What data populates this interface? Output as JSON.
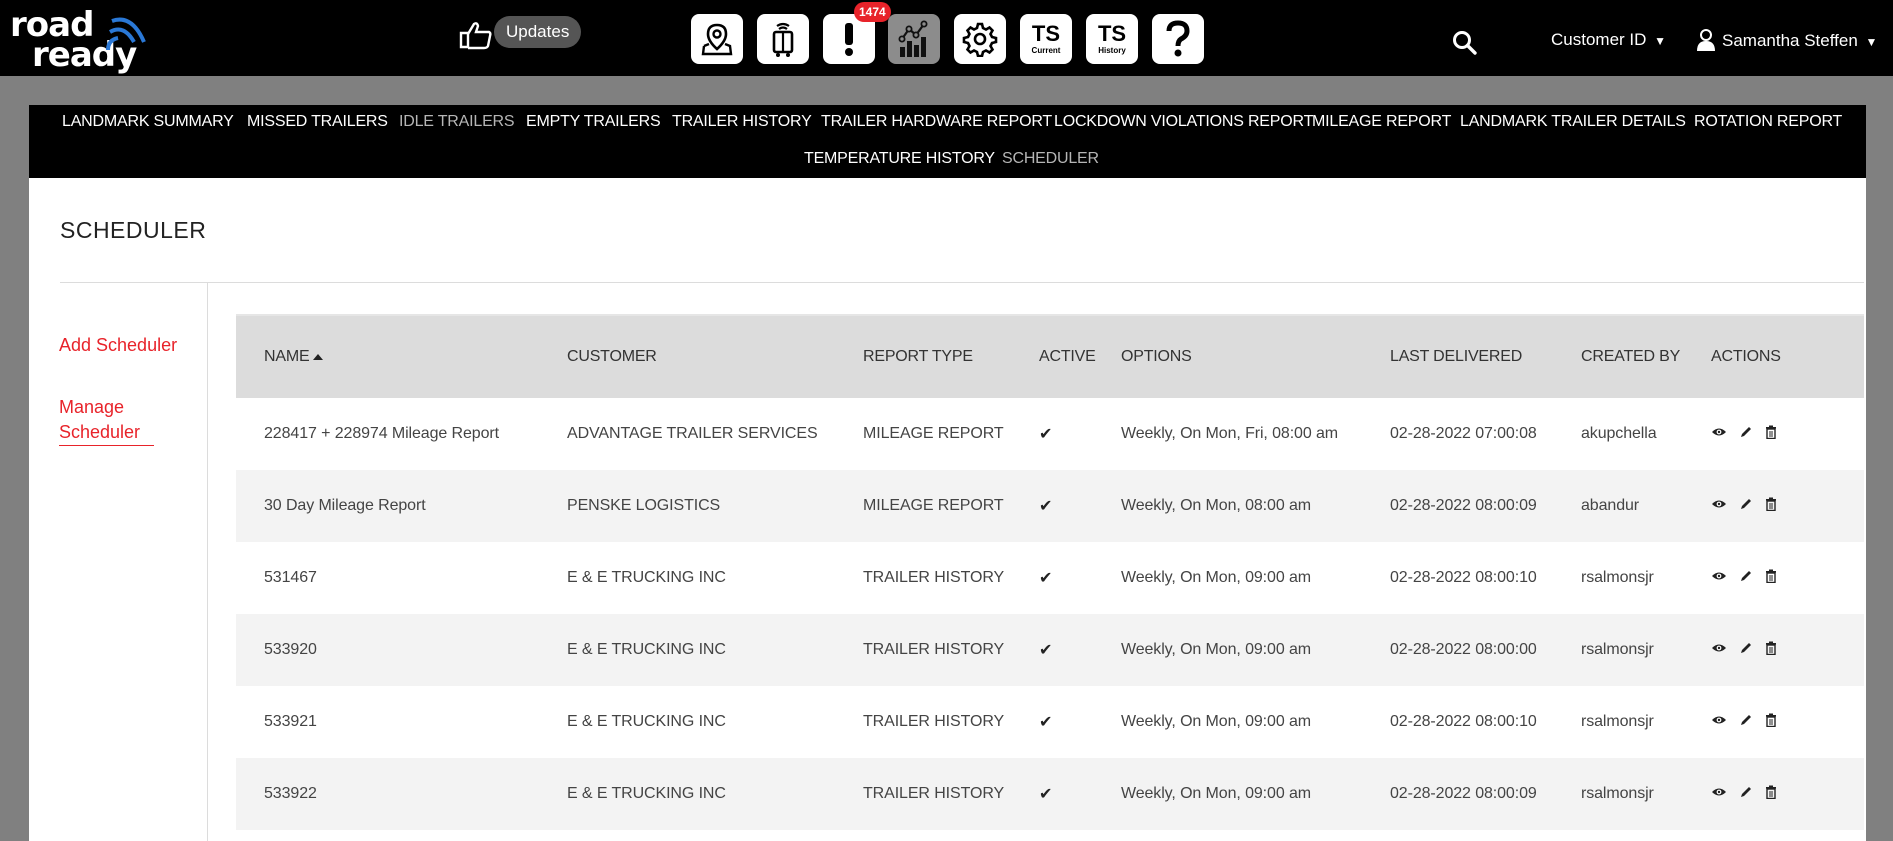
{
  "brand": {
    "line1": "road",
    "line2": "ready"
  },
  "header": {
    "updates_label": "Updates",
    "alert_count": "1474",
    "toolbar_icons": [
      {
        "name": "landmark-map-icon"
      },
      {
        "name": "trailer-icon"
      },
      {
        "name": "alert-icon"
      },
      {
        "name": "reports-chart-icon",
        "active": true
      },
      {
        "name": "settings-gear-icon"
      },
      {
        "name": "ts-current",
        "main": "TS",
        "sub": "Current"
      },
      {
        "name": "ts-history",
        "main": "TS",
        "sub": "History"
      },
      {
        "name": "help-icon"
      }
    ],
    "customer_label": "Customer ID",
    "user_name": "Samantha Steffen",
    "dropdown_glyph": "▼"
  },
  "nav": {
    "items": [
      "LANDMARK SUMMARY",
      "MISSED TRAILERS",
      "IDLE TRAILERS",
      "EMPTY TRAILERS",
      "TRAILER HISTORY",
      "TRAILER HARDWARE REPORT",
      "LOCKDOWN VIOLATIONS REPORT",
      "MILEAGE REPORT",
      "LANDMARK TRAILER DETAILS",
      "ROTATION REPORT",
      "TEMPERATURE HISTORY",
      "SCHEDULER"
    ],
    "dimmed": [
      "IDLE TRAILERS",
      "SCHEDULER"
    ]
  },
  "page": {
    "title": "SCHEDULER",
    "sidebar": {
      "add": "Add Scheduler",
      "manage": "Manage Scheduler"
    }
  },
  "table": {
    "columns": [
      "NAME",
      "CUSTOMER",
      "REPORT TYPE",
      "ACTIVE",
      "OPTIONS",
      "LAST DELIVERED",
      "CREATED BY",
      "ACTIONS"
    ],
    "rows": [
      {
        "name": "228417 + 228974 Mileage Report",
        "customer": "ADVANTAGE TRAILER SERVICES",
        "report_type": "MILEAGE REPORT",
        "active": "✔",
        "options": "Weekly, On Mon, Fri, 08:00 am",
        "last_delivered": "02-28-2022 07:00:08",
        "created_by": "akupchella"
      },
      {
        "name": "30 Day Mileage Report",
        "customer": "PENSKE LOGISTICS",
        "report_type": "MILEAGE REPORT",
        "active": "✔",
        "options": "Weekly, On Mon, 08:00 am",
        "last_delivered": "02-28-2022 08:00:09",
        "created_by": "abandur"
      },
      {
        "name": "531467",
        "customer": "E & E TRUCKING INC",
        "report_type": "TRAILER HISTORY",
        "active": "✔",
        "options": "Weekly, On Mon, 09:00 am",
        "last_delivered": "02-28-2022 08:00:10",
        "created_by": "rsalmonsjr"
      },
      {
        "name": "533920",
        "customer": "E & E TRUCKING INC",
        "report_type": "TRAILER HISTORY",
        "active": "✔",
        "options": "Weekly, On Mon, 09:00 am",
        "last_delivered": "02-28-2022 08:00:00",
        "created_by": "rsalmonsjr"
      },
      {
        "name": "533921",
        "customer": "E & E TRUCKING INC",
        "report_type": "TRAILER HISTORY",
        "active": "✔",
        "options": "Weekly, On Mon, 09:00 am",
        "last_delivered": "02-28-2022 08:00:10",
        "created_by": "rsalmonsjr"
      },
      {
        "name": "533922",
        "customer": "E & E TRUCKING INC",
        "report_type": "TRAILER HISTORY",
        "active": "✔",
        "options": "Weekly, On Mon, 09:00 am",
        "last_delivered": "02-28-2022 08:00:09",
        "created_by": "rsalmonsjr"
      }
    ],
    "row_actions": [
      "view-icon",
      "edit-icon",
      "delete-icon"
    ]
  },
  "colors": {
    "accent": "#e8232a",
    "header_bg": "#000000",
    "page_bg": "#808080",
    "table_header_bg": "#dcdcdc"
  }
}
